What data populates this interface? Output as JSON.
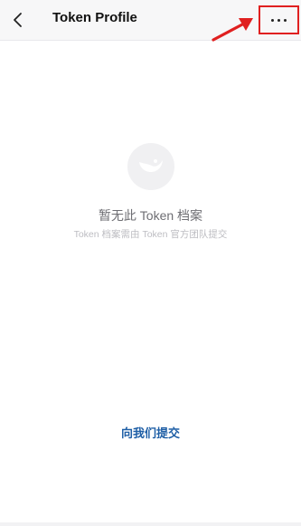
{
  "header": {
    "title": "Token Profile",
    "back_icon": "chevron-left-icon",
    "more_icon": "more-horizontal-icon"
  },
  "empty_state": {
    "logo_icon": "wallet-logo-icon",
    "title": "暂无此 Token 档案",
    "subtitle": "Token 档案需由 Token 官方团队提交"
  },
  "actions": {
    "submit_label": "向我们提交"
  },
  "colors": {
    "header_bg": "#f7f7f8",
    "highlight": "#e02020",
    "link": "#1f5fa6",
    "muted_text": "#6e6e73",
    "subtle_text": "#bdbdc2"
  }
}
